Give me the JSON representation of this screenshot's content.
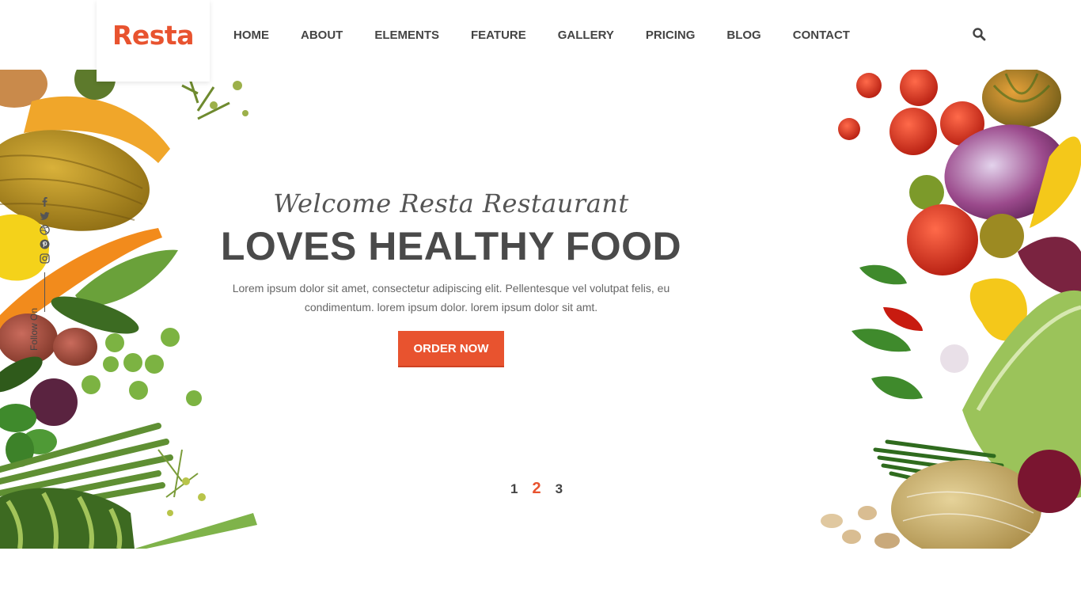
{
  "brand": {
    "name": "Resta",
    "color": "#e8532f"
  },
  "nav": {
    "items": [
      "HOME",
      "ABOUT",
      "ELEMENTS",
      "FEATURE",
      "GALLERY",
      "PRICING",
      "BLOG",
      "CONTACT"
    ],
    "search_icon": "search-icon"
  },
  "hero": {
    "welcome": "Welcome Resta Restaurant",
    "headline": "LOVES HEALTHY FOOD",
    "lead": "Lorem ipsum dolor sit amet, consectetur adipiscing elit. Pellentesque vel volutpat felis, eu condimentum. lorem ipsum dolor. lorem ipsum dolor sit amt.",
    "cta": "ORDER NOW",
    "cta_color": "#e8532f"
  },
  "social": {
    "icons": [
      "facebook-icon",
      "twitter-icon",
      "dribbble-icon",
      "pinterest-icon",
      "instagram-icon"
    ],
    "follow_label": "Follow On"
  },
  "slider": {
    "pages": [
      "1",
      "2",
      "3"
    ],
    "active": "2"
  }
}
